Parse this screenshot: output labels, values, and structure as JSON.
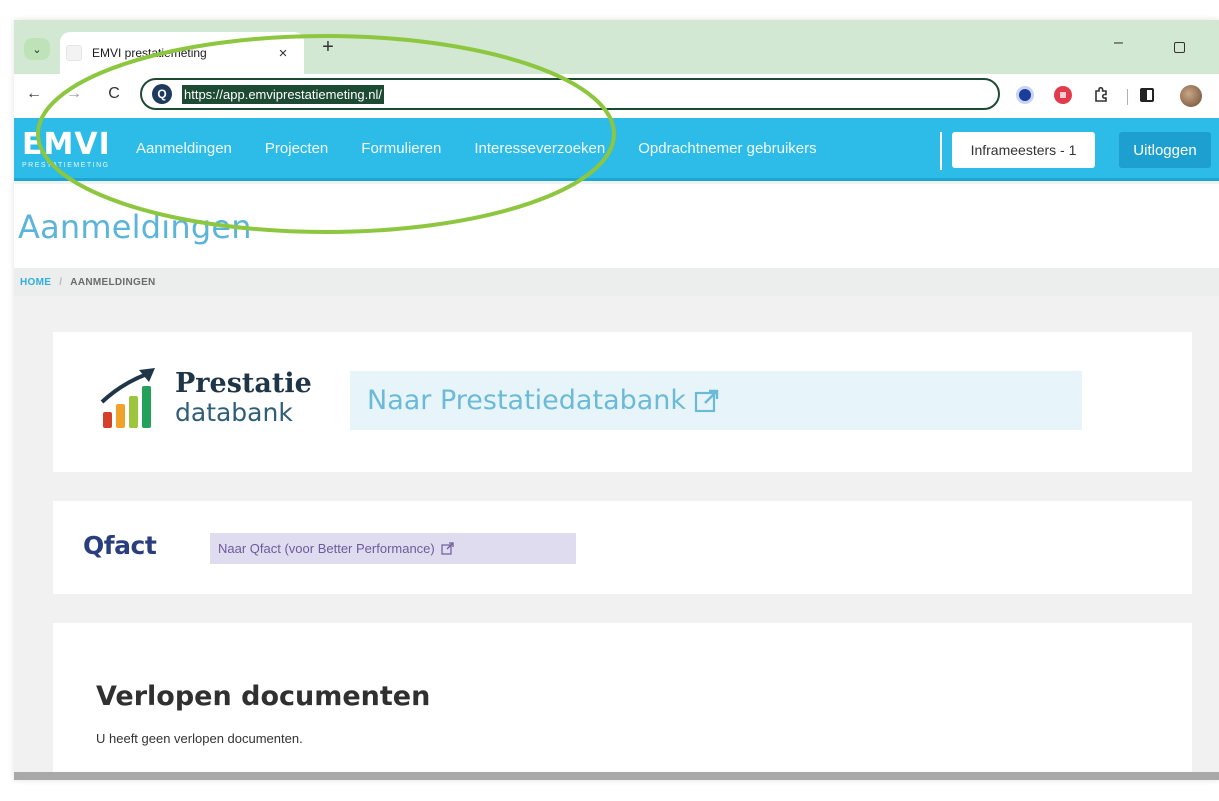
{
  "browser": {
    "tab_title": "EMVI prestatiemeting",
    "tab_close": "×",
    "new_tab": "+",
    "window_minimize": "–",
    "url": "https://app.emviprestatiemeting.nl/",
    "nav_back": "←",
    "nav_forward": "→",
    "nav_reload": "C",
    "site_icon_letter": "Q",
    "tab_menu": "⌄"
  },
  "app_nav": {
    "brand": "EMVI",
    "brand_sub": "PRESTATIEMETING",
    "links": [
      "Aanmeldingen",
      "Projecten",
      "Formulieren",
      "Interesseverzoeken",
      "Opdrachtnemer gebruikers"
    ],
    "organisation_button": "Inframeesters - 1",
    "logout_button": "Uitloggen",
    "accent_color": "#2dbbe8"
  },
  "page": {
    "title": "Aanmeldingen",
    "breadcrumb": {
      "home": "HOME",
      "separator": "/",
      "current": "AANMELDINGEN"
    }
  },
  "prestatiedatabank": {
    "logo_line_1": "Prestatie",
    "logo_line_2": "databank",
    "button": "Naar Prestatiedatabank"
  },
  "qfact": {
    "logo": "Qfact",
    "button": "Naar Qfact (voor Better Performance)"
  },
  "expired_documents": {
    "title": "Verlopen documenten",
    "message": "U heeft geen verlopen documenten."
  },
  "icons": [
    "chevron-down-icon",
    "close-icon",
    "plus-icon",
    "back-arrow-icon",
    "forward-arrow-icon",
    "reload-icon",
    "site-info-icon",
    "password-manager-icon",
    "extension-icon",
    "puzzle-icon",
    "side-panel-icon",
    "avatar",
    "external-link-icon"
  ],
  "annotation_color": "#8dc63f"
}
